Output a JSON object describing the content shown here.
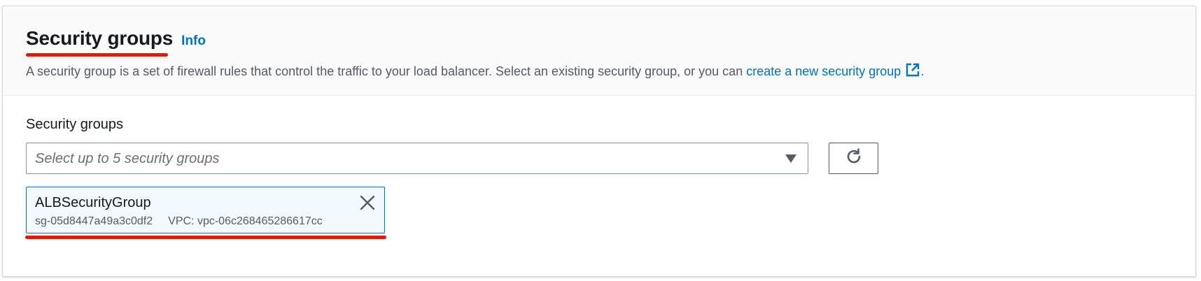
{
  "section": {
    "title": "Security groups",
    "info_label": "Info",
    "description_prefix": "A security group is a set of firewall rules that control the traffic to your load balancer. Select an existing security group, or you can ",
    "description_link": "create a new security group",
    "description_suffix": "."
  },
  "field": {
    "label": "Security groups",
    "placeholder": "Select up to 5 security groups"
  },
  "selected_token": {
    "name": "ALBSecurityGroup",
    "id": "sg-05d8447a49a3c0df2",
    "vpc": "VPC: vpc-06c268465286617cc"
  },
  "icons": {
    "external_link": "external-link-icon",
    "caret": "caret-down-icon",
    "refresh": "refresh-icon",
    "close": "close-icon"
  },
  "colors": {
    "link": "#0073bb",
    "highlight_underline": "#e3170a",
    "token_background": "#f1faff",
    "token_border": "#0073bb"
  }
}
